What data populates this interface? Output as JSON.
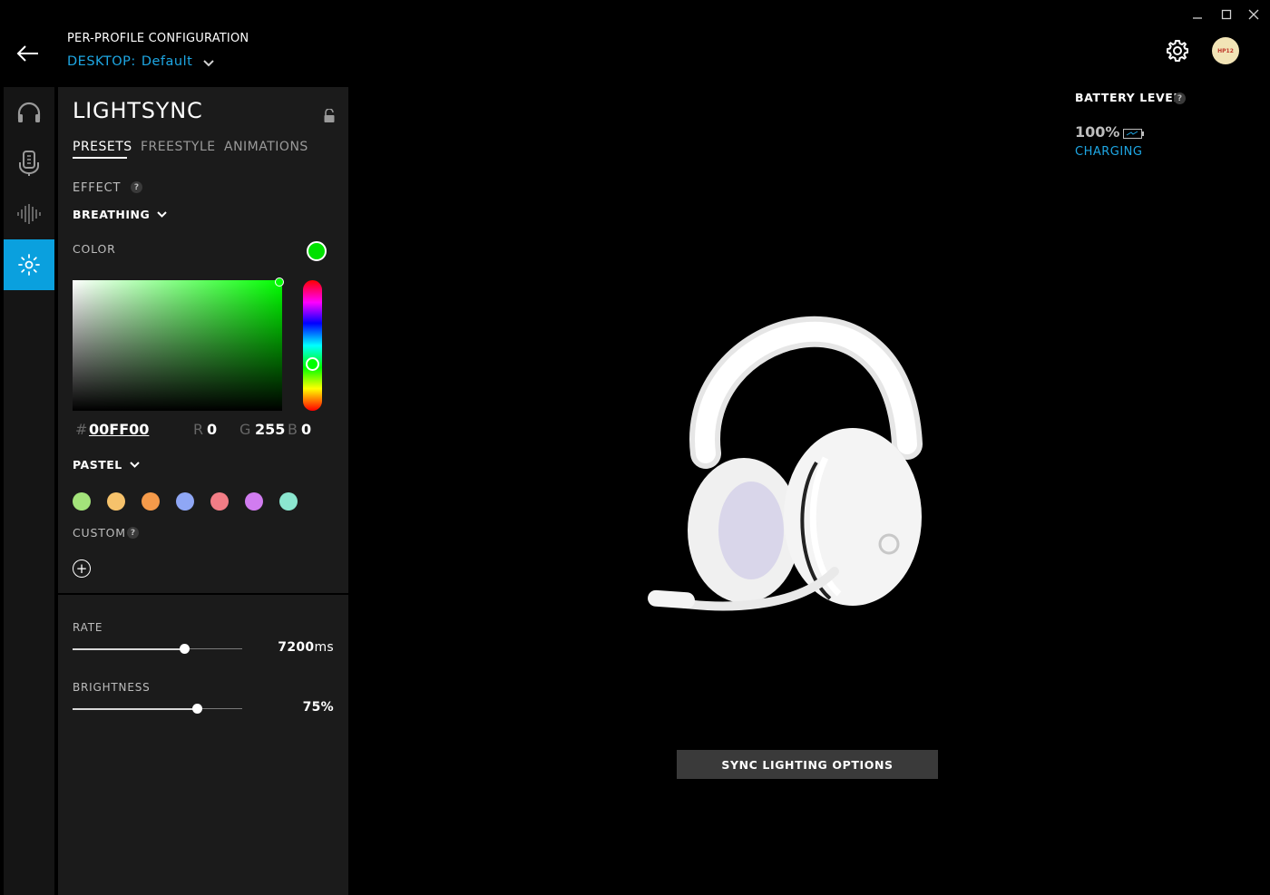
{
  "window": {
    "minimize_icon": "minimize-icon",
    "maximize_icon": "maximize-icon",
    "close_icon": "close-icon"
  },
  "header": {
    "title": "PER-PROFILE CONFIGURATION",
    "profile_prefix": "DESKTOP:",
    "profile_name": "Default",
    "avatar_text": "HP12"
  },
  "rail": {
    "items": [
      {
        "icon": "headset-icon",
        "active": false
      },
      {
        "icon": "microphone-icon",
        "active": false
      },
      {
        "icon": "equalizer-icon",
        "active": false
      },
      {
        "icon": "lighting-icon",
        "active": true
      }
    ]
  },
  "panel": {
    "title": "LIGHTSYNC",
    "tabs": [
      {
        "label": "PRESETS",
        "active": true
      },
      {
        "label": "FREESTYLE",
        "active": false
      },
      {
        "label": "ANIMATIONS",
        "active": false
      }
    ],
    "effect_label": "EFFECT",
    "effect_value": "BREATHING",
    "color_label": "COLOR",
    "selected_color": "#00FF00",
    "hex_symbol": "#",
    "hex_value": "00FF00",
    "r_label": "R",
    "r_value": "0",
    "g_label": "G",
    "g_value": "255",
    "b_label": "B",
    "b_value": "0",
    "palette_name": "PASTEL",
    "swatches": [
      "#a3e37a",
      "#f6c26b",
      "#f59a4a",
      "#8fa7f5",
      "#f27d86",
      "#d17cf0",
      "#8be6cf"
    ],
    "custom_label": "CUSTOM",
    "help_glyph": "?",
    "add_glyph": "+",
    "rate_label": "RATE",
    "rate_value": "7200",
    "rate_unit": "ms",
    "rate_fraction": 0.66,
    "brightness_label": "BRIGHTNESS",
    "brightness_value": "75%",
    "brightness_fraction": 0.73
  },
  "battery": {
    "title": "BATTERY LEVEL",
    "help_glyph": "?",
    "value": "100%",
    "status": "CHARGING"
  },
  "sync_button": "SYNC LIGHTING OPTIONS",
  "accent_color": "#0aa0de"
}
